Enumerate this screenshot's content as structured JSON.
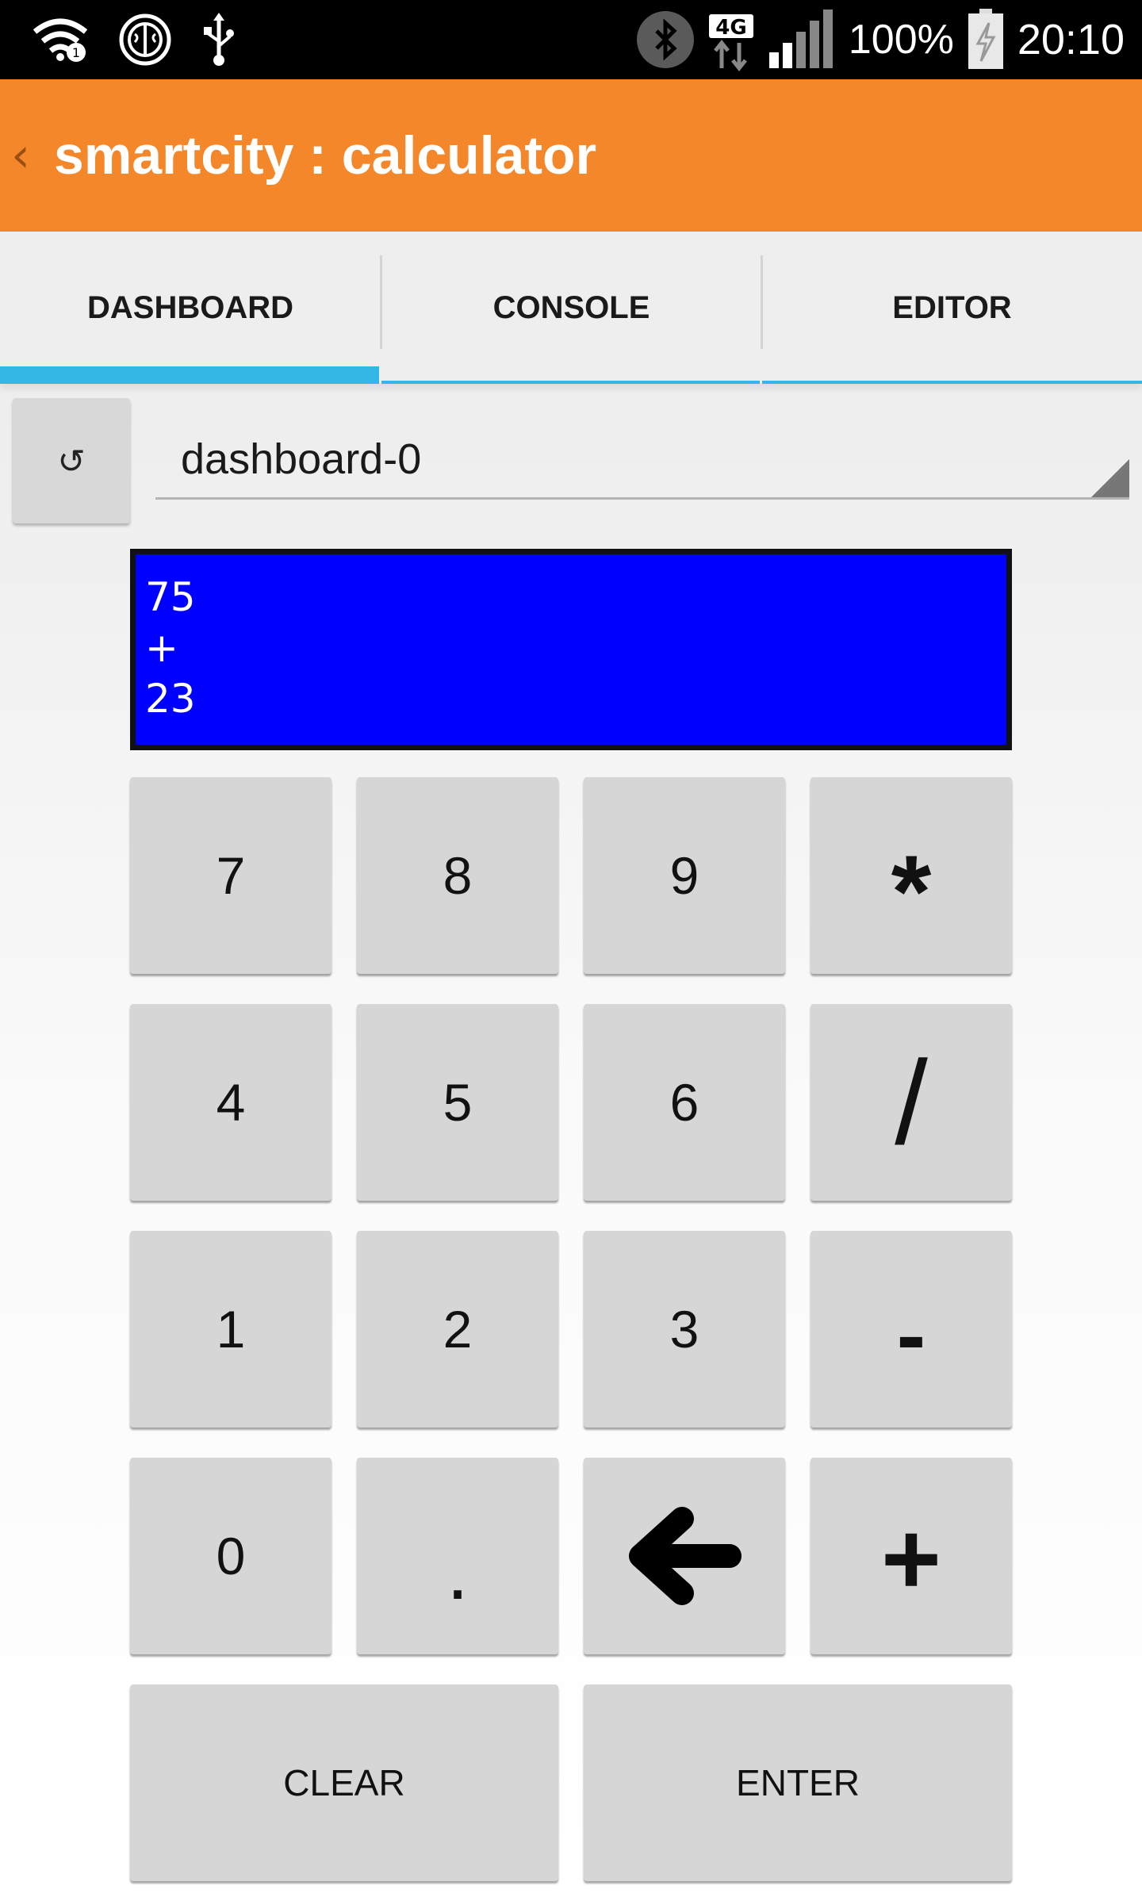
{
  "status_bar": {
    "icons_left": [
      "wifi-icon",
      "brain-icon",
      "usb-icon"
    ],
    "icons_right": [
      "bluetooth-icon",
      "network-4g-icon",
      "signal-icon",
      "battery-charging-icon"
    ],
    "network_label": "4G",
    "battery_percent": "100%",
    "time": "20:10"
  },
  "app_bar": {
    "back_glyph": "‹",
    "title": "smartcity : calculator",
    "color": "#f5872b"
  },
  "tabs": [
    {
      "label": "DASHBOARD",
      "active": true
    },
    {
      "label": "CONSOLE",
      "active": false
    },
    {
      "label": "EDITOR",
      "active": false
    }
  ],
  "tab_indicator_color": "#33b5e5",
  "selector": {
    "refresh_icon": "refresh-icon",
    "refresh_glyph": "↺",
    "value": "dashboard-0"
  },
  "display": {
    "background": "#0000ff",
    "lines": [
      "75",
      "+",
      "23"
    ]
  },
  "keypad": {
    "rows": [
      [
        "7",
        "8",
        "9",
        "*"
      ],
      [
        "4",
        "5",
        "6",
        "/"
      ],
      [
        "1",
        "2",
        "3",
        "-"
      ],
      [
        "0",
        ".",
        "←",
        "+"
      ]
    ],
    "backspace_icon": "arrow-left-icon",
    "clear_label": "CLEAR",
    "enter_label": "ENTER"
  }
}
